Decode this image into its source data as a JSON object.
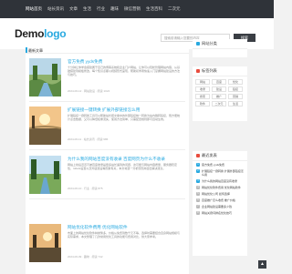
{
  "nav": {
    "items": [
      "网站首页",
      "站长资讯",
      "文章",
      "生活",
      "行业",
      "趣味",
      "微信营销",
      "生活百科",
      "二次元"
    ]
  },
  "brand": {
    "logo_main": "Demo",
    "logo_accent": "logo"
  },
  "search": {
    "placeholder": "搜索前请输入您要的内容",
    "button_label": "搜索"
  },
  "main": {
    "section_title": "最新文章",
    "articles": [
      {
        "title": "官方免费 yyds免费",
        "summary": "十分钟让你学会搭建属于自己的博客系统和企业门户网站，让你可以轻松管理网站内容，从基础搭建到模板修改，每个知识点都以视频形式呈现，帮助初学者快速入门掌握网站建设的方法与技巧。",
        "meta": "2024-06-12 · 网站建设 · 阅读 1024"
      },
      {
        "title": "扩展链接一键转换 扩展外部链接怎么用",
        "summary": "扩展链接一键转换工具可以帮助站长把文章中的外部链接统一转换为站内跳转链接，既方便统计点击数据，又可以降低权重流失，使用方法简单，只需配置规则即可自动生效。",
        "meta": "2024-06-11 · 站长资讯 · 阅读 986"
      },
      {
        "title": "为什么我的网站百度没有收录 百度网页为什么不收录",
        "summary": "网站上线后迟迟不被百度收录是很多站长遇到的问题，这可能与网站内容质量、服务器稳定性、robots设置以及外链建设等因素有关，本文将逐一分析原因并给出解决建议。",
        "meta": "2024-06-10 · 行业 · 阅读 875"
      },
      {
        "title": "网站优化软件费用 优化网站软件",
        "summary": "市面上的网站优化软件种类繁多，价格从免费到数千元不等，选择时需要结合自身网站规模与实际需求，本文整理了几款常用优化工具的功能与费用对比，供大家参考。",
        "meta": "2024-06-09 · 趣味 · 阅读 742"
      }
    ]
  },
  "sidebar": {
    "stats_title": "网站分类",
    "tags_title": "标签列表",
    "tags": [
      "网站",
      "百度",
      "优化",
      "收录",
      "建设",
      "链接",
      "搜索",
      "推广",
      "营销",
      "软件",
      "二次元",
      "生活"
    ],
    "recent_title": "最近发表",
    "recent": [
      "官方免费 yyds免费",
      "扩展链接一键转换 扩展外部链接怎么用",
      "为什么我的网站百度没有收录",
      "网站优化软件费用 优化网站软件",
      "网站优化公司 如何选择",
      "百度推广怎么收费 推广价格",
      "企业网站建设需要多少钱",
      "网站关键词排名优化技巧"
    ]
  },
  "colors": {
    "accent": "#28a9e0",
    "topbar": "#2f3339"
  }
}
